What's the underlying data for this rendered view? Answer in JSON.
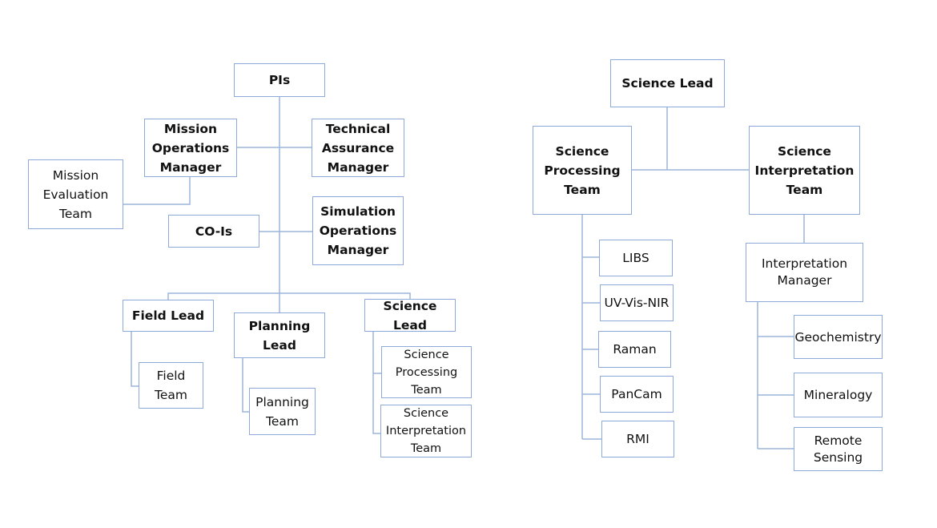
{
  "left_chart": {
    "pis": "PIs",
    "mission_operations_manager": "Mission\nOperations\nManager",
    "technical_assurance_manager": "Technical\nAssurance\nManager",
    "mission_evaluation_team": "Mission\nEvaluation\nTeam",
    "co_is": "CO-Is",
    "simulation_operations_manager": "Simulation\nOperations\nManager",
    "field_lead": "Field Lead",
    "planning_lead": "Planning\nLead",
    "science_lead": "Science Lead",
    "field_team": "Field\nTeam",
    "planning_team": "Planning\nTeam",
    "science_processing_team": "Science\nProcessing\nTeam",
    "science_interpretation_team": "Science\nInterpretation\nTeam"
  },
  "right_chart": {
    "science_lead": "Science Lead",
    "science_processing_team": "Science\nProcessing\nTeam",
    "science_interpretation_team": "Science\nInterpretation\nTeam",
    "processing_items": [
      "LIBS",
      "UV-Vis-NIR",
      "Raman",
      "PanCam",
      "RMI"
    ],
    "interpretation_manager": "Interpretation\nManager",
    "interpretation_items": [
      "Geochemistry",
      "Mineralogy",
      "Remote\nSensing"
    ]
  },
  "colors": {
    "box_border": "#8eaadb",
    "connector": "#9bb5da"
  }
}
